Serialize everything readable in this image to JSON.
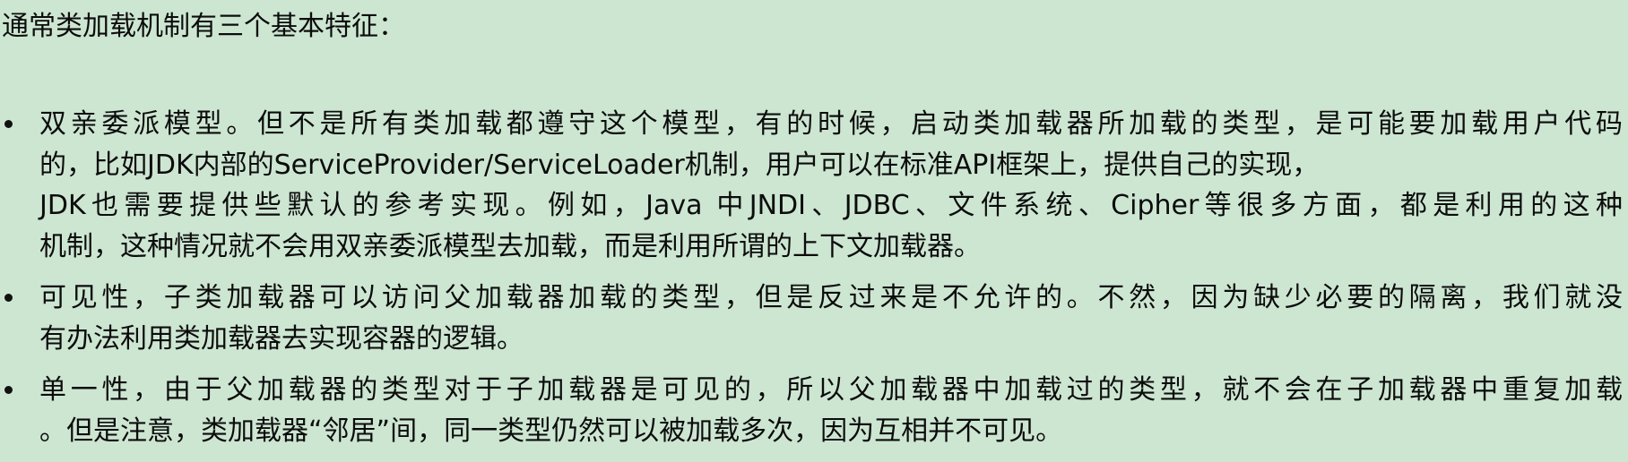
{
  "intro": "通常类加载机制有三个基本特征：",
  "bullets": [
    {
      "lines": [
        "双亲委派模型。但不是所有类加载都遵守这个模型，有的时候，启动类加载器所加载的类型，是可能要加载用户代码",
        "的，比如JDK内部的ServiceProvider/ServiceLoader机制，用户可以在标准API框架上，提供自己的实现，",
        "JDK也需要提供些默认的参考实现。例如，Java 中JNDI、JDBC、文件系统、Cipher等很多方面，都是利用的这种",
        "机制，这种情况就不会用双亲委派模型去加载，而是利用所谓的上下文加载器。"
      ]
    },
    {
      "lines": [
        "可见性，子类加载器可以访问父加载器加载的类型，但是反过来是不允许的。不然，因为缺少必要的隔离，我们就没",
        "有办法利用类加载器去实现容器的逻辑。"
      ]
    },
    {
      "lines": [
        "单一性，由于父加载器的类型对于子加载器是可见的，所以父加载器中加载过的类型，就不会在子加载器中重复加载",
        "。但是注意，类加载器“邻居”间，同一类型仍然可以被加载多次，因为互相并不可见。"
      ]
    }
  ]
}
